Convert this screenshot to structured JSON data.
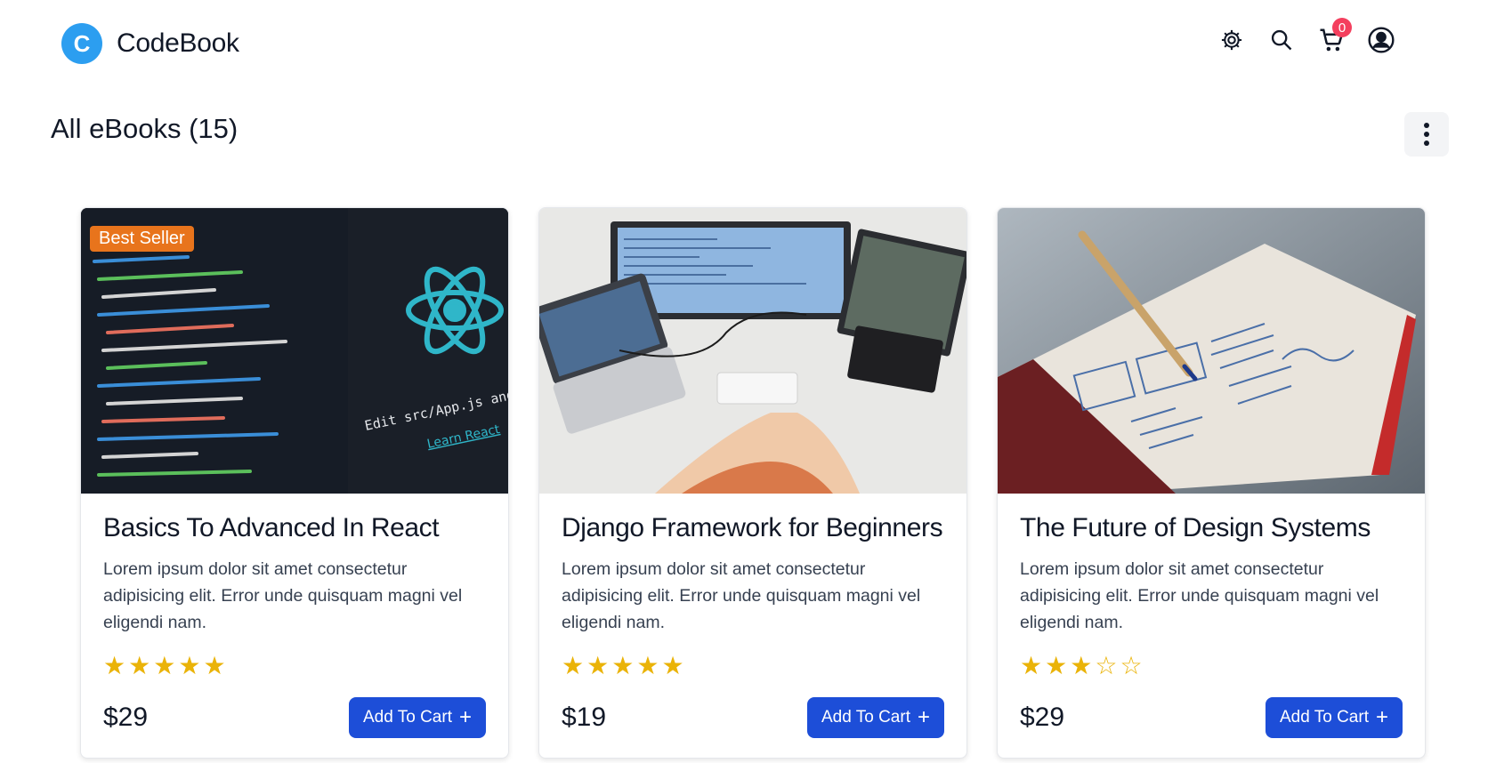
{
  "header": {
    "logo_letter": "C",
    "brand": "CodeBook",
    "cart_count": "0",
    "icons": [
      "gear-icon",
      "search-icon",
      "cart-icon",
      "user-icon"
    ]
  },
  "section": {
    "title": "All eBooks (15)"
  },
  "colors": {
    "accent": "#1d4ed8",
    "logo": "#2c9ef0",
    "badge": "#f43f5e",
    "best_seller": "#e8741c",
    "star": "#eab308"
  },
  "products": [
    {
      "title": "Basics To Advanced In React",
      "description": "Lorem ipsum dolor sit amet consectetur adipisicing elit. Error unde quisquam magni vel eligendi nam.",
      "rating": 5,
      "rating_max": 5,
      "price": "$29",
      "best_seller": "Best Seller",
      "button": "Add To Cart"
    },
    {
      "title": "Django Framework for Beginners",
      "description": "Lorem ipsum dolor sit amet consectetur adipisicing elit. Error unde quisquam magni vel eligendi nam.",
      "rating": 5,
      "rating_max": 5,
      "price": "$19",
      "button": "Add To Cart"
    },
    {
      "title": "The Future of Design Systems",
      "description": "Lorem ipsum dolor sit amet consectetur adipisicing elit. Error unde quisquam magni vel eligendi nam.",
      "rating": 3,
      "rating_max": 5,
      "price": "$29",
      "button": "Add To Cart"
    }
  ]
}
